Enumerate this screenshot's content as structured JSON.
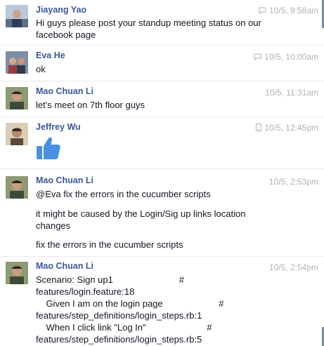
{
  "messages": [
    {
      "sender": "Jiayang Yao",
      "time": "10/5, 9:58am",
      "via": "chat-bubble-icon",
      "lines": [
        "Hi guys please post your standup meeting status on our",
        "facebook page"
      ]
    },
    {
      "sender": "Eva He",
      "time": "10/5, 10:00am",
      "via": "chat-bubble-icon",
      "lines": [
        "ok"
      ]
    },
    {
      "sender": "Mao Chuan Li",
      "time": "10/5, 11:31am",
      "lines": [
        "let's meet on 7th floor guys"
      ]
    },
    {
      "sender": "Jeffrey Wu",
      "time": "10/5, 12:45pm",
      "via": "mobile-phone-icon",
      "sticker": "thumbs-up-icon"
    },
    {
      "sender": "Mao Chuan Li",
      "time": "10/5, 2:53pm",
      "lines": [
        "@Eva fix the errors in the cucumber scripts",
        "it might be caused by the Login/Sig up links location",
        "changes",
        "fix the errors in the cucumber scripts"
      ]
    },
    {
      "sender": "Mao Chuan Li",
      "time": "10/5, 2:54pm",
      "lines": [
        "Scenario: Sign up1                          #",
        "features/login.feature:18",
        "    Given I am on the login page                      #",
        "features/step_definitions/login_steps.rb:1",
        "    When I click link \"Log In\"                        #",
        "features/step_definitions/login_steps.rb:5"
      ]
    }
  ],
  "colors": {
    "name": "#3b5998",
    "time": "#adb2bb",
    "like": "#4a90e2"
  }
}
